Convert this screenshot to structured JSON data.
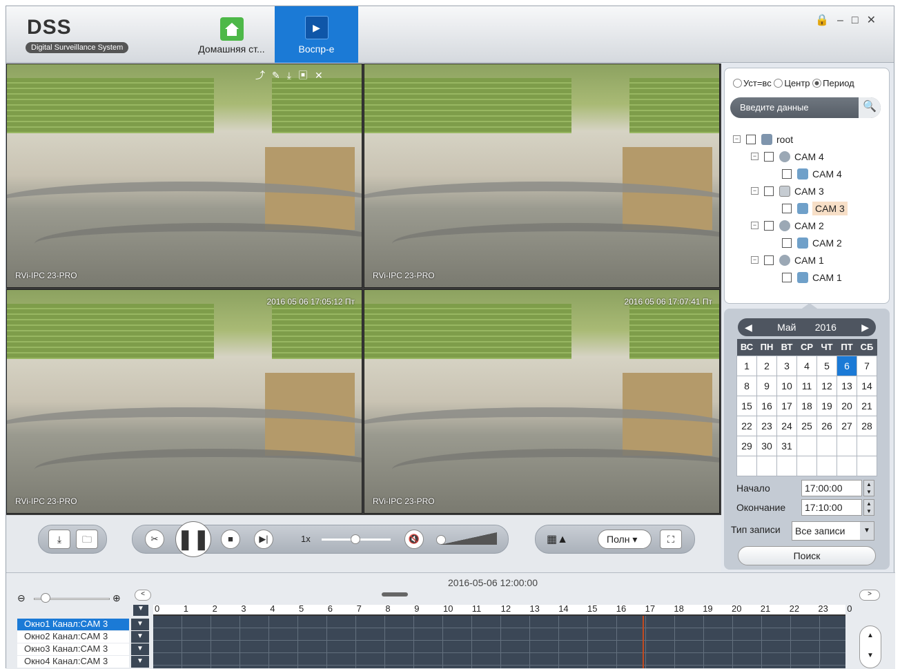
{
  "app": {
    "title": "DSS",
    "subtitle": "Digital Surveillance System"
  },
  "tabs": [
    {
      "label": "Домашняя ст..."
    },
    {
      "label": "Воспр-е"
    }
  ],
  "window_controls": [
    "lock",
    "minimize",
    "maximize",
    "close"
  ],
  "video": {
    "cells": [
      {
        "camera_label": "RVi-IPC 23-PRO",
        "timestamp": ""
      },
      {
        "camera_label": "RVi-IPC 23-PRO",
        "timestamp": ""
      },
      {
        "camera_label": "RVi-IPC 23-PRO",
        "timestamp": "2016 05 06 17:05:12 Пт"
      },
      {
        "camera_label": "RVi-IPC 23-PRO",
        "timestamp": "2016 05 06 17:07:41 Пт"
      }
    ],
    "cell_tools": [
      "export-icon",
      "pin-icon",
      "download-icon",
      "snapshot-icon",
      "close-icon"
    ]
  },
  "controls": {
    "speed": "1x",
    "layout_mode": "Полн"
  },
  "search": {
    "radio_options": [
      "Уст=вс",
      "Центр",
      "Период"
    ],
    "selected_radio": "Период",
    "placeholder": "Введите данные"
  },
  "tree": [
    {
      "label": "root",
      "level": 0,
      "icon": "root"
    },
    {
      "label": "CAM 4",
      "level": 1,
      "icon": "dev"
    },
    {
      "label": "CAM 4",
      "level": 2,
      "icon": "cam"
    },
    {
      "label": "CAM 3",
      "level": 1,
      "icon": "nvr"
    },
    {
      "label": "CAM 3",
      "level": 2,
      "icon": "cam",
      "selected": true
    },
    {
      "label": "CAM 2",
      "level": 1,
      "icon": "dev"
    },
    {
      "label": "CAM 2",
      "level": 2,
      "icon": "cam"
    },
    {
      "label": "CAM 1",
      "level": 1,
      "icon": "dev"
    },
    {
      "label": "CAM 1",
      "level": 2,
      "icon": "cam"
    }
  ],
  "calendar": {
    "month": "Май",
    "year": "2016",
    "weekdays": [
      "ВС",
      "ПН",
      "ВТ",
      "СР",
      "ЧТ",
      "ПТ",
      "СБ"
    ],
    "weeks": [
      [
        "1",
        "2",
        "3",
        "4",
        "5",
        "6",
        "7"
      ],
      [
        "8",
        "9",
        "10",
        "11",
        "12",
        "13",
        "14"
      ],
      [
        "15",
        "16",
        "17",
        "18",
        "19",
        "20",
        "21"
      ],
      [
        "22",
        "23",
        "24",
        "25",
        "26",
        "27",
        "28"
      ],
      [
        "29",
        "30",
        "31",
        "",
        "",
        "",
        ""
      ],
      [
        "",
        "",
        "",
        "",
        "",
        "",
        ""
      ]
    ],
    "selected_day": "6"
  },
  "time": {
    "start_label": "Начало",
    "start": "17:00:00",
    "end_label": "Окончание",
    "end": "17:10:00"
  },
  "record_type": {
    "label": "Тип записи",
    "value": "Все записи"
  },
  "search_button": "Поиск",
  "timeline": {
    "date": "2016-05-06 12:00:00",
    "hours": [
      "0",
      "1",
      "2",
      "3",
      "4",
      "5",
      "6",
      "7",
      "8",
      "9",
      "10",
      "11",
      "12",
      "13",
      "14",
      "15",
      "16",
      "17",
      "18",
      "19",
      "20",
      "21",
      "22",
      "23",
      "0"
    ],
    "channels": [
      "Окно1 Канал:CAM 3",
      "Окно2 Канал:CAM 3",
      "Окно3 Канал:CAM 3",
      "Окно4 Канал:CAM 3"
    ]
  },
  "colors": {
    "accent": "#1b7ad6",
    "timeline_bg": "#3b4756",
    "cursor": "#c24a1f"
  }
}
